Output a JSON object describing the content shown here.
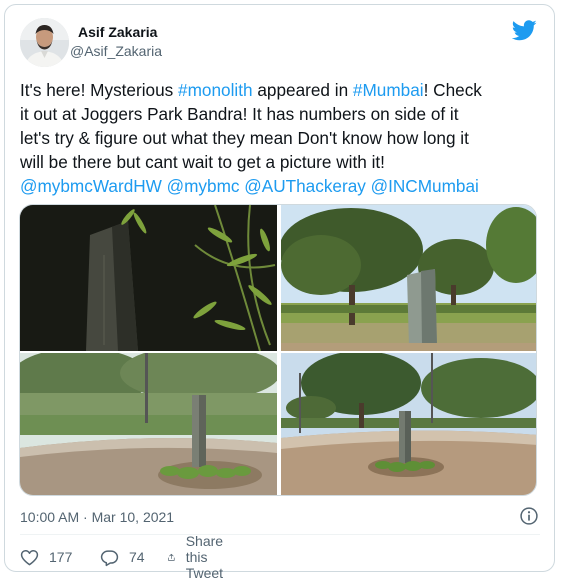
{
  "author": {
    "name": "Asif Zakaria",
    "handle": "@Asif_Zakaria",
    "avatar_icon": "profile-photo"
  },
  "brand": {
    "logo_icon": "twitter-bird-icon",
    "color": "#1d9bf0"
  },
  "tweet": {
    "lines": [
      [
        {
          "t": "It's here! Mysterious "
        },
        {
          "t": "#monolith",
          "link": true
        },
        {
          "t": " appeared in "
        },
        {
          "t": "#Mumbai",
          "link": true
        },
        {
          "t": "! Check"
        }
      ],
      [
        {
          "t": "it out at Joggers Park Bandra! It has  numbers on side of it"
        }
      ],
      [
        {
          "t": "let's try & figure out what they mean Don't know how long it"
        }
      ],
      [
        {
          "t": "will be there but cant wait to get a picture with it!"
        }
      ],
      [
        {
          "t": "@mybmcWardHW",
          "link": true
        },
        {
          "t": " "
        },
        {
          "t": "@mybmc",
          "link": true
        },
        {
          "t": " "
        },
        {
          "t": "@AUThackeray",
          "link": true
        },
        {
          "t": " "
        },
        {
          "t": "@INCMumbai",
          "link": true
        }
      ]
    ]
  },
  "media": {
    "photos": [
      "monolith-night-closeup",
      "monolith-park-lawn",
      "monolith-garden-bed",
      "monolith-seafront-park"
    ]
  },
  "meta": {
    "timestamp": "10:00 AM · Mar 10, 2021",
    "info_icon": "info-icon"
  },
  "actions": {
    "like_count": "177",
    "reply_count": "74",
    "share_label": "Share this Tweet"
  },
  "colors": {
    "text": "#0f1419",
    "secondary": "#536471",
    "link": "#1d9bf0",
    "border": "#cfd9de"
  }
}
